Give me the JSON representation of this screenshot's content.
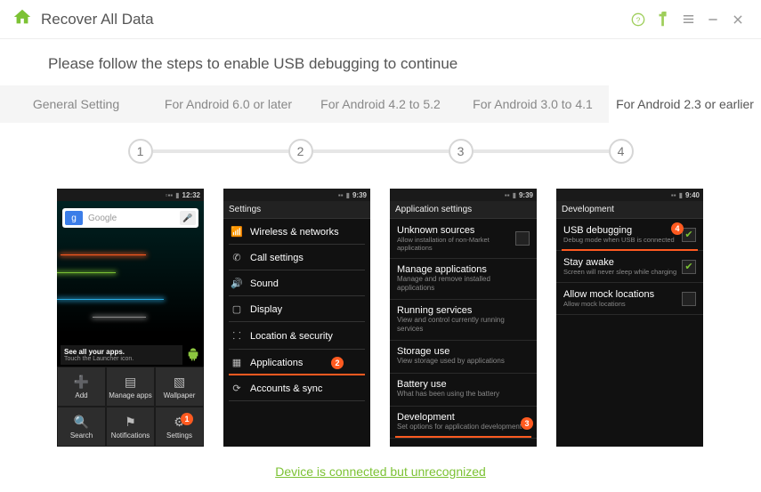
{
  "window": {
    "title": "Recover All Data"
  },
  "instruction": "Please follow the steps to enable USB debugging to continue",
  "tabs": [
    {
      "label": "General Setting"
    },
    {
      "label": "For Android 6.0 or later"
    },
    {
      "label": "For Android 4.2 to 5.2"
    },
    {
      "label": "For Android 3.0 to 4.1"
    },
    {
      "label": "For Android 2.3 or earlier"
    }
  ],
  "active_tab_index": 4,
  "steps": [
    "1",
    "2",
    "3",
    "4"
  ],
  "phone1": {
    "time": "12:32",
    "search_placeholder": "Google",
    "hint_title": "See all your apps.",
    "hint_sub": "Touch the Launcher icon.",
    "dock": [
      "Add",
      "Manage apps",
      "Wallpaper",
      "Search",
      "Notifications",
      "Settings"
    ],
    "badge": "1"
  },
  "phone2": {
    "time": "9:39",
    "header": "Settings",
    "items": [
      "Wireless & networks",
      "Call settings",
      "Sound",
      "Display",
      "Location & security",
      "Applications",
      "Accounts & sync"
    ],
    "badge": "2"
  },
  "phone3": {
    "time": "9:39",
    "header": "Application settings",
    "items": [
      {
        "title": "Unknown sources",
        "sub": "Allow installation of non-Market applications",
        "chk": true
      },
      {
        "title": "Manage applications",
        "sub": "Manage and remove installed applications"
      },
      {
        "title": "Running services",
        "sub": "View and control currently running services"
      },
      {
        "title": "Storage use",
        "sub": "View storage used by applications"
      },
      {
        "title": "Battery use",
        "sub": "What has been using the battery"
      },
      {
        "title": "Development",
        "sub": "Set options for application development"
      }
    ],
    "badge": "3"
  },
  "phone4": {
    "time": "9:40",
    "header": "Development",
    "items": [
      {
        "title": "USB debugging",
        "sub": "Debug mode when USB is connected",
        "chk": true
      },
      {
        "title": "Stay awake",
        "sub": "Screen will never sleep while charging",
        "chk": true
      },
      {
        "title": "Allow mock locations",
        "sub": "Allow mock locations",
        "chk": false
      }
    ],
    "badge": "4"
  },
  "footer_link": "Device is connected but unrecognized"
}
